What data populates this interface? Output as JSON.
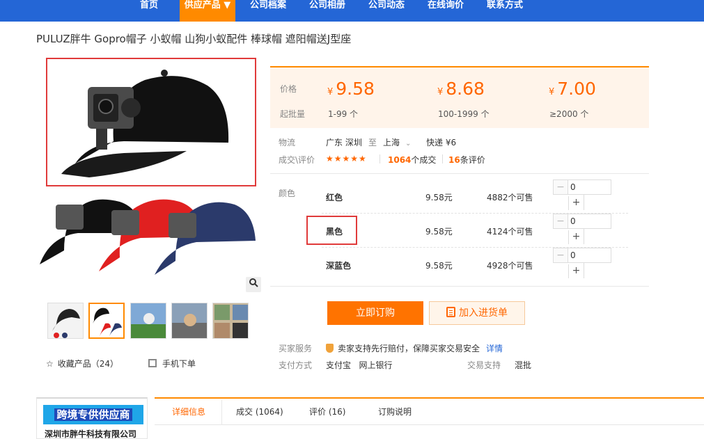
{
  "nav": {
    "items": [
      "首页",
      "供应产品 ▼",
      "公司档案",
      "公司相册",
      "公司动态",
      "在线询价",
      "联系方式"
    ]
  },
  "product": {
    "title": "PULUZ胖牛 Gopro帽子 小蚁帽 山狗小蚁配件 棒球帽 遮阳帽送J型座"
  },
  "price": {
    "label_price": "价格",
    "label_moq": "起批量",
    "currency": "¥",
    "tiers": [
      {
        "price": "9.58",
        "qty": "1-99 个"
      },
      {
        "price": "8.68",
        "qty": "100-1999 个"
      },
      {
        "price": "7.00",
        "qty": "≥2000 个"
      }
    ]
  },
  "logistics": {
    "label": "物流",
    "from": "广东 深圳",
    "to_word": "至",
    "to": "上海",
    "express": "快递 ¥6"
  },
  "deals": {
    "label": "成交\\评价",
    "stars": "★★★★★",
    "count": "1064",
    "count_suffix": "个成交",
    "reviews": "16",
    "reviews_suffix": "条评价"
  },
  "color": {
    "label": "颜色",
    "skus": [
      {
        "name": "红色",
        "price": "9.58元",
        "stock": "4882个可售",
        "qty": "0"
      },
      {
        "name": "黑色",
        "price": "9.58元",
        "stock": "4124个可售",
        "qty": "0"
      },
      {
        "name": "深蓝色",
        "price": "9.58元",
        "stock": "4928个可售",
        "qty": "0"
      }
    ],
    "minus": "−",
    "plus": "+"
  },
  "actions": {
    "buy": "立即订购",
    "cart": "加入进货单"
  },
  "service": {
    "label": "买家服务",
    "text": "卖家支持先行赔付，保障买家交易安全",
    "link": "详情"
  },
  "payment": {
    "label": "支付方式",
    "methods": "支付宝   网上银行",
    "support_label": "交易支持",
    "support_value": "混批"
  },
  "gallery": {
    "favorite": "收藏产品（24）",
    "mobile": "手机下单"
  },
  "company": {
    "banner": "跨境专供供应商",
    "name": "深圳市胖牛科技有限公司"
  },
  "tabs": [
    "详细信息",
    "成交 (1064)",
    "评价 (16)",
    "订购说明"
  ],
  "colors": {
    "nav_bg": "#2466d6",
    "accent": "#ff7300",
    "price": "#ff6600",
    "highlight": "#e03a3a"
  }
}
